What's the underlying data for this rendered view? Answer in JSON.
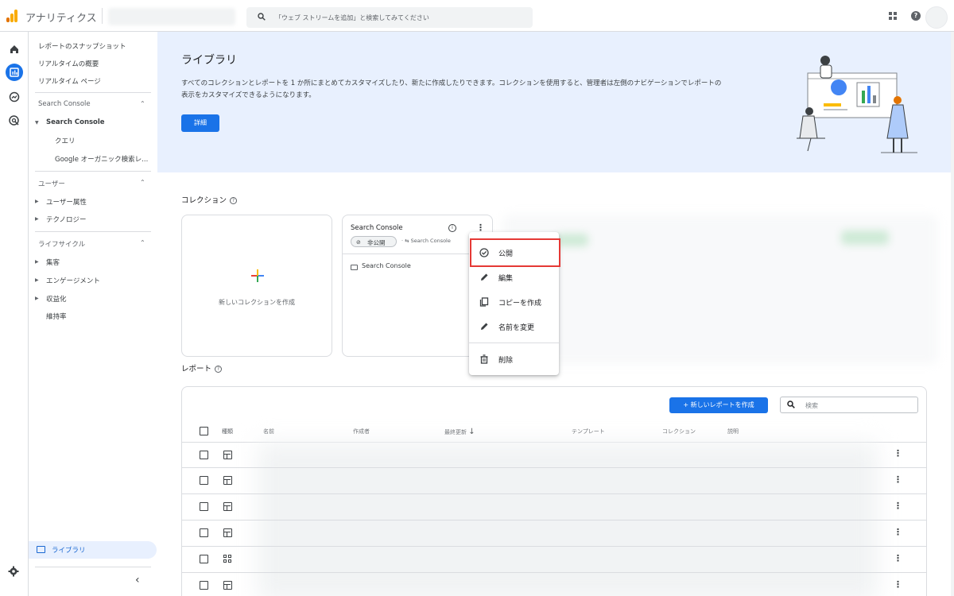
{
  "app": {
    "title": "アナリティクス",
    "search_placeholder": "「ウェブ ストリームを追加」と検索してみてください"
  },
  "sidebar": {
    "items_top": [
      "レポートのスナップショット",
      "リアルタイムの概要",
      "リアルタイム ページ"
    ],
    "section_search_console": "Search Console",
    "search_console_group": "Search Console",
    "search_console_children": [
      "クエリ",
      "Google オーガニック検索レ..."
    ],
    "section_user": "ユーザー",
    "user_items": [
      "ユーザー属性",
      "テクノロジー"
    ],
    "section_lifecycle": "ライフサイクル",
    "lifecycle_items": [
      "集客",
      "エンゲージメント",
      "収益化",
      "維持率"
    ],
    "library": "ライブラリ"
  },
  "banner": {
    "title": "ライブラリ",
    "description": "すべてのコレクションとレポートを 1 か所にまとめてカスタマイズしたり、新たに作成したりできます。コレクションを使用すると、管理者は左側のナビゲーションでレポートの表示をカスタマイズできるようになります。",
    "details_button": "詳細"
  },
  "collections": {
    "label": "コレクション",
    "new_collection": "新しいコレクションを作成",
    "card": {
      "title": "Search Console",
      "badge": "非公開",
      "source": "Search Console",
      "folder": "Search Console"
    }
  },
  "menu": {
    "items": [
      {
        "label": "公開",
        "icon": "check-circle-icon"
      },
      {
        "label": "編集",
        "icon": "pencil-icon"
      },
      {
        "label": "コピーを作成",
        "icon": "copy-icon"
      },
      {
        "label": "名前を変更",
        "icon": "pencil-icon"
      },
      {
        "label": "削除",
        "icon": "trash-icon"
      }
    ]
  },
  "reports": {
    "label": "レポート",
    "new_report": "+ 新しいレポートを作成",
    "search_placeholder": "検索",
    "columns": [
      "種類",
      "名前",
      "作成者",
      "最終更新",
      "テンプレート",
      "コレクション",
      "説明"
    ]
  },
  "colors": {
    "accent": "#1a73e8",
    "banner_bg": "#e8f0fe",
    "highlight": "#e53935"
  }
}
